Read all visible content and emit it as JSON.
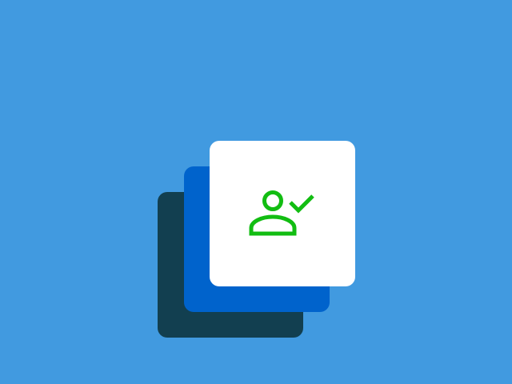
{
  "colors": {
    "background": "#419ae0",
    "card_back": "#123f50",
    "card_mid": "#0063cc",
    "card_front": "#ffffff",
    "icon_accent": "#12bd12"
  },
  "icon": {
    "name": "user-check-icon"
  }
}
